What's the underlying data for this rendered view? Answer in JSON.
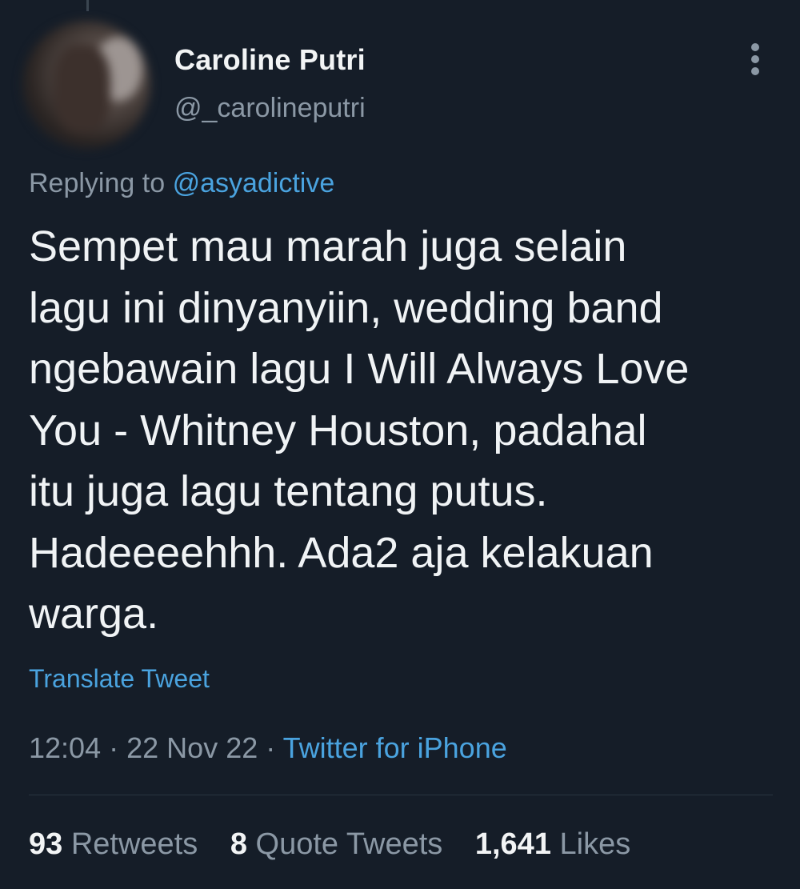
{
  "tweet": {
    "author": {
      "display_name": "Caroline Putri",
      "handle": "@_carolineputri"
    },
    "reply": {
      "prefix": "Replying to",
      "mention": "@asyadictive"
    },
    "text": "Sempet mau marah juga selain\nlagu ini dinyanyiin, wedding band\nngebawain lagu I Will Always Love\nYou - Whitney Houston, padahal\nitu juga lagu tentang putus.\nHadeeeehhh. Ada2 aja kelakuan\nwarga.",
    "translate_label": "Translate Tweet",
    "meta": {
      "time": "12:04",
      "separator": "·",
      "date": "22 Nov 22",
      "source": "Twitter for iPhone"
    },
    "stats": {
      "retweets": {
        "count": "93",
        "label": "Retweets"
      },
      "quotes": {
        "count": "8",
        "label": "Quote Tweets"
      },
      "likes": {
        "count": "1,641",
        "label": "Likes"
      }
    }
  },
  "icons": {
    "more": "more-vertical-icon"
  },
  "colors": {
    "background": "#151d28",
    "link": "#4aa3df",
    "secondary_text": "#8b98a5",
    "primary_text": "#f0f3f5"
  }
}
